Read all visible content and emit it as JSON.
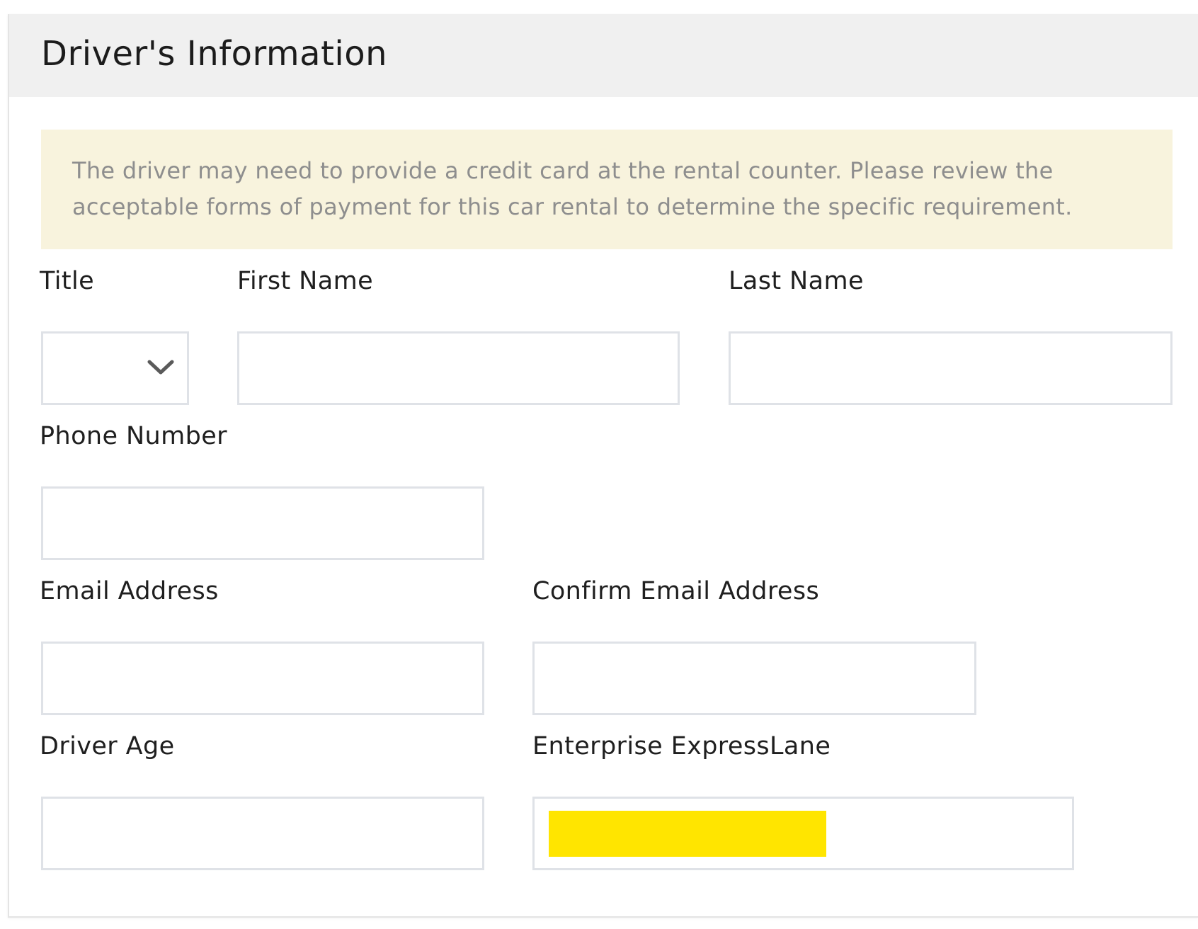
{
  "section": {
    "title": "Driver's Information",
    "notice": "The driver may need to provide a credit card at the rental counter. Please review the acceptable forms of payment for this car rental to determine the specific requirement."
  },
  "fields": {
    "title": {
      "label": "Title",
      "value": ""
    },
    "first_name": {
      "label": "First Name",
      "value": ""
    },
    "last_name": {
      "label": "Last Name",
      "value": ""
    },
    "phone_number": {
      "label": "Phone Number",
      "value": ""
    },
    "email_address": {
      "label": "Email Address",
      "value": ""
    },
    "confirm_email_address": {
      "label": "Confirm Email Address",
      "value": ""
    },
    "driver_age": {
      "label": "Driver Age",
      "value": ""
    },
    "expresslane": {
      "label": "Enterprise ExpressLane",
      "value": ""
    }
  },
  "icons": {
    "title_select": "chevron-down-icon"
  },
  "colors": {
    "header_background": "#f0f0f0",
    "notice_background": "#f8f3dd",
    "notice_text": "#8e8e8e",
    "input_border": "#dfe2e7",
    "redaction_highlight": "#ffe500"
  }
}
